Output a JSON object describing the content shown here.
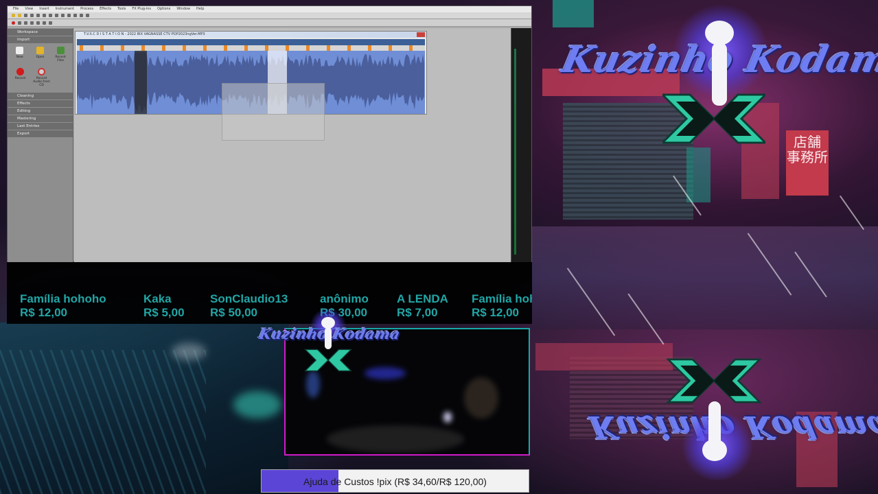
{
  "app": {
    "menu": [
      "File",
      "View",
      "Insert",
      "Instrument",
      "Process",
      "Effects",
      "Tools",
      "FX Plug-ins",
      "Options",
      "Window",
      "Help"
    ],
    "sidebar": {
      "workspace": "Workspace",
      "import": "Import",
      "import_items": [
        "New",
        "Open",
        "Recent Files"
      ],
      "record_items": [
        "Record",
        "Record Audio from CD"
      ],
      "sections": [
        "Cleaning",
        "Effects",
        "Editing",
        "Mastering",
        "Last Entries",
        "Export"
      ]
    },
    "wave_window_title": "T.V.X.C D I S T A T I O N - 2022 BIX VAGNASSE CTV POP2023ngVer.MP3"
  },
  "logos": {
    "top_right": "Kuzinho Kodama",
    "cam_overlay": "Kuzinho Kodama",
    "bottom_right": "Kuzinho Kodama"
  },
  "city_sign": "店舗\n事務所",
  "donors": [
    {
      "name": "Família hohoho",
      "amount": "R$ 12,00"
    },
    {
      "name": "Kaka",
      "amount": "R$ 5,00"
    },
    {
      "name": "SonClaudio13",
      "amount": "R$ 50,00"
    },
    {
      "name": "anônimo",
      "amount": "R$ 30,00"
    },
    {
      "name": "A LENDA",
      "amount": "R$ 7,00"
    },
    {
      "name": "Família hohoho",
      "amount": "R$ 12,00"
    }
  ],
  "goal": {
    "label": "Ajuda de Custos !pix (R$ 34,60/R$ 120,00)",
    "current": 34.6,
    "target": 120.0,
    "fill_color": "#5b45d6"
  },
  "colors": {
    "donor_text": "#22a6a6",
    "cam_border_magenta": "#d31ac9",
    "cam_border_teal": "#18a9a9",
    "waveform": "#6f8ed6"
  }
}
